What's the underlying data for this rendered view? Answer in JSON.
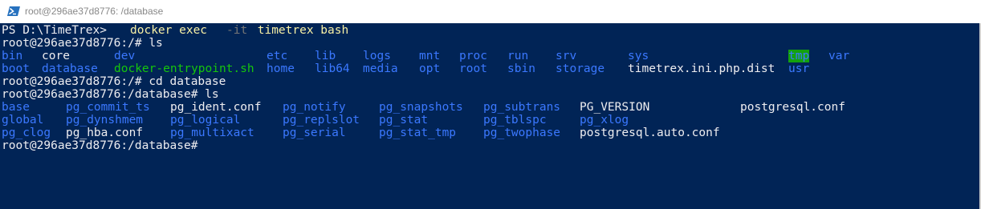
{
  "window": {
    "title": "root@296ae37d8776: /database",
    "icon": "powershell-icon",
    "bg": "#012456"
  },
  "terminal": {
    "lines": [
      {
        "segments": [
          {
            "text": "PS D:\\TimeTrex> ",
            "style": "w"
          },
          {
            "text": "docker exec ",
            "style": "cmd"
          },
          {
            "text": "-it",
            "style": "par"
          },
          {
            "text": " timetrex bash",
            "style": "cmd"
          }
        ]
      },
      {
        "segments": [
          {
            "text": "root@296ae37d8776:/# ls",
            "style": "w"
          }
        ]
      },
      {
        "segments": [
          {
            "text": "bin",
            "style": "dir",
            "col": 0
          },
          {
            "text": "core",
            "style": "w",
            "col": 5
          },
          {
            "text": "dev",
            "style": "dir",
            "col": 14
          },
          {
            "text": "etc",
            "style": "dir",
            "col": 33
          },
          {
            "text": "lib",
            "style": "dir",
            "col": 39
          },
          {
            "text": "logs",
            "style": "dir",
            "col": 45
          },
          {
            "text": "mnt",
            "style": "dir",
            "col": 52
          },
          {
            "text": "proc",
            "style": "dir",
            "col": 57
          },
          {
            "text": "run",
            "style": "dir",
            "col": 63
          },
          {
            "text": "srv",
            "style": "dir",
            "col": 69
          },
          {
            "text": "sys",
            "style": "dir",
            "col": 78
          },
          {
            "text": "tmp",
            "style": "hl",
            "col": 98
          },
          {
            "text": "var",
            "style": "dir",
            "col": 103
          }
        ]
      },
      {
        "segments": [
          {
            "text": "boot",
            "style": "dir",
            "col": 0
          },
          {
            "text": "database",
            "style": "dir",
            "col": 5
          },
          {
            "text": "docker-entrypoint.sh",
            "style": "gr",
            "col": 14
          },
          {
            "text": "home",
            "style": "dir",
            "col": 33
          },
          {
            "text": "lib64",
            "style": "dir",
            "col": 39
          },
          {
            "text": "media",
            "style": "dir",
            "col": 45
          },
          {
            "text": "opt",
            "style": "dir",
            "col": 52
          },
          {
            "text": "root",
            "style": "dir",
            "col": 57
          },
          {
            "text": "sbin",
            "style": "dir",
            "col": 63
          },
          {
            "text": "storage",
            "style": "dir",
            "col": 69
          },
          {
            "text": "timetrex.ini.php.dist",
            "style": "w",
            "col": 78
          },
          {
            "text": "usr",
            "style": "dir",
            "col": 98
          }
        ]
      },
      {
        "segments": [
          {
            "text": "root@296ae37d8776:/# cd database",
            "style": "w"
          }
        ]
      },
      {
        "segments": [
          {
            "text": "root@296ae37d8776:/database# ls",
            "style": "w"
          }
        ]
      },
      {
        "segments": [
          {
            "text": "base",
            "style": "dir",
            "col": 0
          },
          {
            "text": "pg_commit_ts",
            "style": "dir",
            "col": 8
          },
          {
            "text": "pg_ident.conf",
            "style": "w",
            "col": 21
          },
          {
            "text": "pg_notify",
            "style": "dir",
            "col": 35
          },
          {
            "text": "pg_snapshots",
            "style": "dir",
            "col": 47
          },
          {
            "text": "pg_subtrans",
            "style": "dir",
            "col": 60
          },
          {
            "text": "PG_VERSION",
            "style": "w",
            "col": 72
          },
          {
            "text": "postgresql.conf",
            "style": "w",
            "col": 92
          }
        ]
      },
      {
        "segments": [
          {
            "text": "global",
            "style": "dir",
            "col": 0
          },
          {
            "text": "pg_dynshmem",
            "style": "dir",
            "col": 8
          },
          {
            "text": "pg_logical",
            "style": "dir",
            "col": 21
          },
          {
            "text": "pg_replslot",
            "style": "dir",
            "col": 35
          },
          {
            "text": "pg_stat",
            "style": "dir",
            "col": 47
          },
          {
            "text": "pg_tblspc",
            "style": "dir",
            "col": 60
          },
          {
            "text": "pg_xlog",
            "style": "dir",
            "col": 72
          }
        ]
      },
      {
        "segments": [
          {
            "text": "pg_clog",
            "style": "dir",
            "col": 0
          },
          {
            "text": "pg_hba.conf",
            "style": "w",
            "col": 8
          },
          {
            "text": "pg_multixact",
            "style": "dir",
            "col": 21
          },
          {
            "text": "pg_serial",
            "style": "dir",
            "col": 35
          },
          {
            "text": "pg_stat_tmp",
            "style": "dir",
            "col": 47
          },
          {
            "text": "pg_twophase",
            "style": "dir",
            "col": 60
          },
          {
            "text": "postgresql.auto.conf",
            "style": "w",
            "col": 72
          }
        ]
      },
      {
        "segments": [
          {
            "text": "root@296ae37d8776:/database#",
            "style": "w"
          }
        ]
      }
    ]
  }
}
